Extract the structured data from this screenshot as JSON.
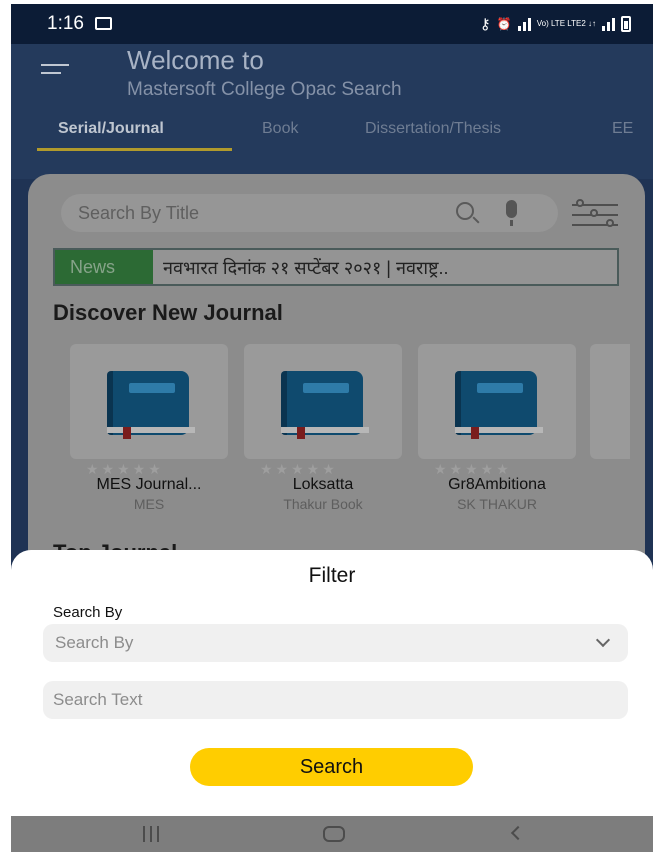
{
  "status_bar": {
    "time": "1:16",
    "network_label": "Vo) LTE LTE2 ↓↑"
  },
  "header": {
    "title": "Welcome to",
    "subtitle": "Mastersoft College Opac Search",
    "tabs": [
      {
        "label": "Serial/Journal",
        "active": true
      },
      {
        "label": "Book",
        "active": false
      },
      {
        "label": "Dissertation/Thesis",
        "active": false
      },
      {
        "label": "EE",
        "active": false
      }
    ]
  },
  "search": {
    "placeholder": "Search By Title"
  },
  "news": {
    "tag": "News",
    "text": "नवभारत दिनांक २१ सप्टेंबर २०२१ | नवराष्ट्र.."
  },
  "discover": {
    "title": "Discover New Journal",
    "items": [
      {
        "title": "MES Journal...",
        "subtitle": "MES",
        "stars": "★★★★★"
      },
      {
        "title": "Loksatta",
        "subtitle": "Thakur Book",
        "stars": "★★★★★"
      },
      {
        "title": "Gr8Ambitiona",
        "subtitle": "SK THAKUR",
        "stars": "★★★★★"
      }
    ]
  },
  "top_journal": {
    "title": "Top Journal"
  },
  "filter_sheet": {
    "title": "Filter",
    "search_by_label": "Search By",
    "search_by_value": "Search By",
    "search_text_placeholder": "Search Text",
    "search_button": "Search"
  },
  "colors": {
    "accent": "#ffcd00",
    "header_bg": "#243a5c",
    "news_tag": "#2c6a34"
  },
  "icons": {
    "menu": "hamburger-icon",
    "search": "search-icon",
    "mic": "mic-icon",
    "filter": "filter-sliders-icon",
    "dropdown": "chevron-down-icon",
    "nav_recent": "recent-apps-icon",
    "nav_home": "home-icon",
    "nav_back": "back-icon"
  }
}
